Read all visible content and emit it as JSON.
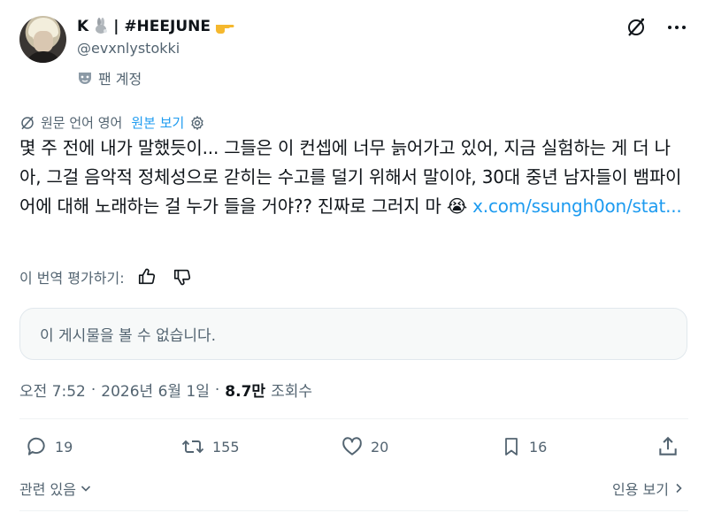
{
  "author": {
    "display_name": "K",
    "display_name_suffix": "| #HEEJUNE",
    "handle": "@evxnlystokki",
    "badge_label": "팬 계정"
  },
  "translation": {
    "notice": "원문 언어 영어",
    "show_original": "원본 보기"
  },
  "tweet": {
    "text": "몇 주 전에 내가 말했듯이... 그들은 이 컨셉에 너무 늙어가고 있어, 지금 실험하는 게 더 나아, 그걸 음악적 정체성으로 갇히는 수고를 덜기 위해서 말이야, 30대 중년 남자들이 뱀파이어에 대해 노래하는 걸 누가 들을 거야?? 진짜로 그러지 마 ",
    "emoji": "😭",
    "link": "x.com/ssungh0on/stat..."
  },
  "rate_translation": "이 번역 평가하기:",
  "unavailable_notice": "이 게시물을 볼 수 없습니다.",
  "meta": {
    "time": "오전 7:52",
    "date": "2026년 6월 1일",
    "views_count": "8.7만",
    "views_label": "조회수",
    "separator": "·"
  },
  "actions": {
    "replies": "19",
    "reposts": "155",
    "likes": "20",
    "bookmarks": "16"
  },
  "footer": {
    "related": "관련 있음",
    "quotes": "인용 보기"
  },
  "colors": {
    "link": "#1d9bf0",
    "muted": "#536471",
    "text": "#0f1419"
  }
}
